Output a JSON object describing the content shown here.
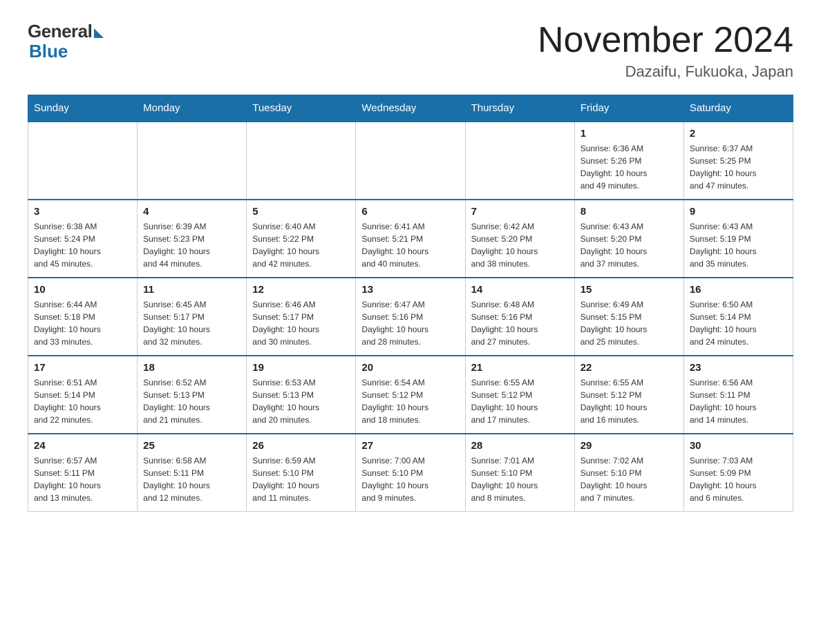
{
  "header": {
    "logo_general": "General",
    "logo_blue": "Blue",
    "month_title": "November 2024",
    "subtitle": "Dazaifu, Fukuoka, Japan"
  },
  "days_of_week": [
    "Sunday",
    "Monday",
    "Tuesday",
    "Wednesday",
    "Thursday",
    "Friday",
    "Saturday"
  ],
  "weeks": [
    [
      {
        "day": "",
        "info": ""
      },
      {
        "day": "",
        "info": ""
      },
      {
        "day": "",
        "info": ""
      },
      {
        "day": "",
        "info": ""
      },
      {
        "day": "",
        "info": ""
      },
      {
        "day": "1",
        "info": "Sunrise: 6:36 AM\nSunset: 5:26 PM\nDaylight: 10 hours\nand 49 minutes."
      },
      {
        "day": "2",
        "info": "Sunrise: 6:37 AM\nSunset: 5:25 PM\nDaylight: 10 hours\nand 47 minutes."
      }
    ],
    [
      {
        "day": "3",
        "info": "Sunrise: 6:38 AM\nSunset: 5:24 PM\nDaylight: 10 hours\nand 45 minutes."
      },
      {
        "day": "4",
        "info": "Sunrise: 6:39 AM\nSunset: 5:23 PM\nDaylight: 10 hours\nand 44 minutes."
      },
      {
        "day": "5",
        "info": "Sunrise: 6:40 AM\nSunset: 5:22 PM\nDaylight: 10 hours\nand 42 minutes."
      },
      {
        "day": "6",
        "info": "Sunrise: 6:41 AM\nSunset: 5:21 PM\nDaylight: 10 hours\nand 40 minutes."
      },
      {
        "day": "7",
        "info": "Sunrise: 6:42 AM\nSunset: 5:20 PM\nDaylight: 10 hours\nand 38 minutes."
      },
      {
        "day": "8",
        "info": "Sunrise: 6:43 AM\nSunset: 5:20 PM\nDaylight: 10 hours\nand 37 minutes."
      },
      {
        "day": "9",
        "info": "Sunrise: 6:43 AM\nSunset: 5:19 PM\nDaylight: 10 hours\nand 35 minutes."
      }
    ],
    [
      {
        "day": "10",
        "info": "Sunrise: 6:44 AM\nSunset: 5:18 PM\nDaylight: 10 hours\nand 33 minutes."
      },
      {
        "day": "11",
        "info": "Sunrise: 6:45 AM\nSunset: 5:17 PM\nDaylight: 10 hours\nand 32 minutes."
      },
      {
        "day": "12",
        "info": "Sunrise: 6:46 AM\nSunset: 5:17 PM\nDaylight: 10 hours\nand 30 minutes."
      },
      {
        "day": "13",
        "info": "Sunrise: 6:47 AM\nSunset: 5:16 PM\nDaylight: 10 hours\nand 28 minutes."
      },
      {
        "day": "14",
        "info": "Sunrise: 6:48 AM\nSunset: 5:16 PM\nDaylight: 10 hours\nand 27 minutes."
      },
      {
        "day": "15",
        "info": "Sunrise: 6:49 AM\nSunset: 5:15 PM\nDaylight: 10 hours\nand 25 minutes."
      },
      {
        "day": "16",
        "info": "Sunrise: 6:50 AM\nSunset: 5:14 PM\nDaylight: 10 hours\nand 24 minutes."
      }
    ],
    [
      {
        "day": "17",
        "info": "Sunrise: 6:51 AM\nSunset: 5:14 PM\nDaylight: 10 hours\nand 22 minutes."
      },
      {
        "day": "18",
        "info": "Sunrise: 6:52 AM\nSunset: 5:13 PM\nDaylight: 10 hours\nand 21 minutes."
      },
      {
        "day": "19",
        "info": "Sunrise: 6:53 AM\nSunset: 5:13 PM\nDaylight: 10 hours\nand 20 minutes."
      },
      {
        "day": "20",
        "info": "Sunrise: 6:54 AM\nSunset: 5:12 PM\nDaylight: 10 hours\nand 18 minutes."
      },
      {
        "day": "21",
        "info": "Sunrise: 6:55 AM\nSunset: 5:12 PM\nDaylight: 10 hours\nand 17 minutes."
      },
      {
        "day": "22",
        "info": "Sunrise: 6:55 AM\nSunset: 5:12 PM\nDaylight: 10 hours\nand 16 minutes."
      },
      {
        "day": "23",
        "info": "Sunrise: 6:56 AM\nSunset: 5:11 PM\nDaylight: 10 hours\nand 14 minutes."
      }
    ],
    [
      {
        "day": "24",
        "info": "Sunrise: 6:57 AM\nSunset: 5:11 PM\nDaylight: 10 hours\nand 13 minutes."
      },
      {
        "day": "25",
        "info": "Sunrise: 6:58 AM\nSunset: 5:11 PM\nDaylight: 10 hours\nand 12 minutes."
      },
      {
        "day": "26",
        "info": "Sunrise: 6:59 AM\nSunset: 5:10 PM\nDaylight: 10 hours\nand 11 minutes."
      },
      {
        "day": "27",
        "info": "Sunrise: 7:00 AM\nSunset: 5:10 PM\nDaylight: 10 hours\nand 9 minutes."
      },
      {
        "day": "28",
        "info": "Sunrise: 7:01 AM\nSunset: 5:10 PM\nDaylight: 10 hours\nand 8 minutes."
      },
      {
        "day": "29",
        "info": "Sunrise: 7:02 AM\nSunset: 5:10 PM\nDaylight: 10 hours\nand 7 minutes."
      },
      {
        "day": "30",
        "info": "Sunrise: 7:03 AM\nSunset: 5:09 PM\nDaylight: 10 hours\nand 6 minutes."
      }
    ]
  ]
}
